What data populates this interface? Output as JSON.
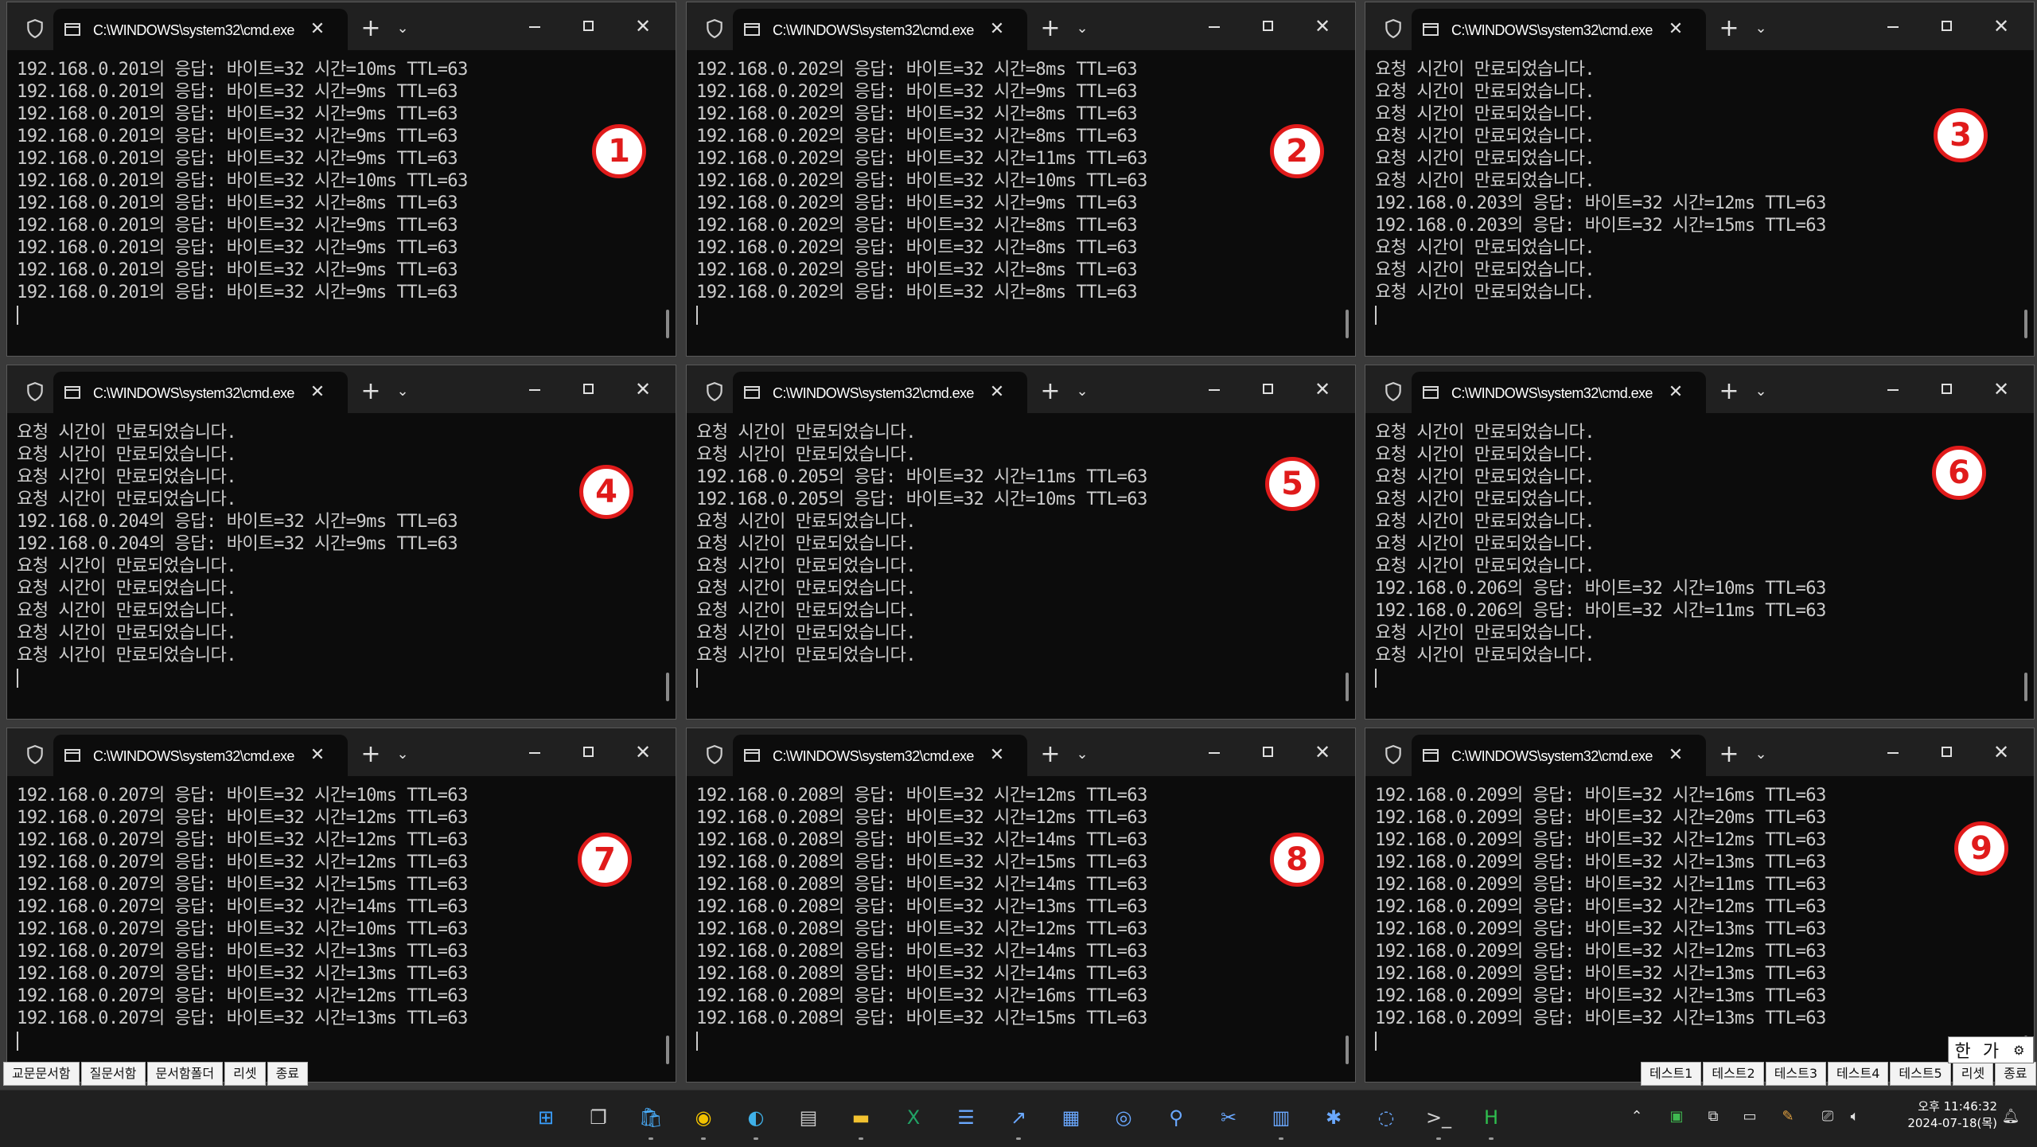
{
  "terminals": [
    {
      "title": "C:\\WINDOWS\\system32\\cmd.exe",
      "close_glyph": "✕",
      "number": "1",
      "lines": [
        "192.168.0.201의 응답: 바이트=32 시간=10ms TTL=63",
        "192.168.0.201의 응답: 바이트=32 시간=9ms TTL=63",
        "192.168.0.201의 응답: 바이트=32 시간=9ms TTL=63",
        "192.168.0.201의 응답: 바이트=32 시간=9ms TTL=63",
        "192.168.0.201의 응답: 바이트=32 시간=9ms TTL=63",
        "192.168.0.201의 응답: 바이트=32 시간=10ms TTL=63",
        "192.168.0.201의 응답: 바이트=32 시간=8ms TTL=63",
        "192.168.0.201의 응답: 바이트=32 시간=9ms TTL=63",
        "192.168.0.201의 응답: 바이트=32 시간=9ms TTL=63",
        "192.168.0.201의 응답: 바이트=32 시간=9ms TTL=63",
        "192.168.0.201의 응답: 바이트=32 시간=9ms TTL=63"
      ]
    },
    {
      "title": "C:\\WINDOWS\\system32\\cmd.exe",
      "close_glyph": "✕",
      "number": "2",
      "lines": [
        "192.168.0.202의 응답: 바이트=32 시간=8ms TTL=63",
        "192.168.0.202의 응답: 바이트=32 시간=9ms TTL=63",
        "192.168.0.202의 응답: 바이트=32 시간=8ms TTL=63",
        "192.168.0.202의 응답: 바이트=32 시간=8ms TTL=63",
        "192.168.0.202의 응답: 바이트=32 시간=11ms TTL=63",
        "192.168.0.202의 응답: 바이트=32 시간=10ms TTL=63",
        "192.168.0.202의 응답: 바이트=32 시간=9ms TTL=63",
        "192.168.0.202의 응답: 바이트=32 시간=8ms TTL=63",
        "192.168.0.202의 응답: 바이트=32 시간=8ms TTL=63",
        "192.168.0.202의 응답: 바이트=32 시간=8ms TTL=63",
        "192.168.0.202의 응답: 바이트=32 시간=8ms TTL=63"
      ]
    },
    {
      "title": "C:\\WINDOWS\\system32\\cmd.exe",
      "close_glyph": "✕",
      "number": "3",
      "lines": [
        "요청 시간이 만료되었습니다.",
        "요청 시간이 만료되었습니다.",
        "요청 시간이 만료되었습니다.",
        "요청 시간이 만료되었습니다.",
        "요청 시간이 만료되었습니다.",
        "요청 시간이 만료되었습니다.",
        "192.168.0.203의 응답: 바이트=32 시간=12ms TTL=63",
        "192.168.0.203의 응답: 바이트=32 시간=15ms TTL=63",
        "요청 시간이 만료되었습니다.",
        "요청 시간이 만료되었습니다.",
        "요청 시간이 만료되었습니다."
      ]
    },
    {
      "title": "C:\\WINDOWS\\system32\\cmd.exe",
      "close_glyph": "✕",
      "number": "4",
      "lines": [
        "요청 시간이 만료되었습니다.",
        "요청 시간이 만료되었습니다.",
        "요청 시간이 만료되었습니다.",
        "요청 시간이 만료되었습니다.",
        "192.168.0.204의 응답: 바이트=32 시간=9ms TTL=63",
        "192.168.0.204의 응답: 바이트=32 시간=9ms TTL=63",
        "요청 시간이 만료되었습니다.",
        "요청 시간이 만료되었습니다.",
        "요청 시간이 만료되었습니다.",
        "요청 시간이 만료되었습니다.",
        "요청 시간이 만료되었습니다."
      ]
    },
    {
      "title": "C:\\WINDOWS\\system32\\cmd.exe",
      "close_glyph": "✕",
      "number": "5",
      "lines": [
        "요청 시간이 만료되었습니다.",
        "요청 시간이 만료되었습니다.",
        "192.168.0.205의 응답: 바이트=32 시간=11ms TTL=63",
        "192.168.0.205의 응답: 바이트=32 시간=10ms TTL=63",
        "요청 시간이 만료되었습니다.",
        "요청 시간이 만료되었습니다.",
        "요청 시간이 만료되었습니다.",
        "요청 시간이 만료되었습니다.",
        "요청 시간이 만료되었습니다.",
        "요청 시간이 만료되었습니다.",
        "요청 시간이 만료되었습니다."
      ]
    },
    {
      "title": "C:\\WINDOWS\\system32\\cmd.exe",
      "close_glyph": "✕",
      "number": "6",
      "lines": [
        "요청 시간이 만료되었습니다.",
        "요청 시간이 만료되었습니다.",
        "요청 시간이 만료되었습니다.",
        "요청 시간이 만료되었습니다.",
        "요청 시간이 만료되었습니다.",
        "요청 시간이 만료되었습니다.",
        "요청 시간이 만료되었습니다.",
        "192.168.0.206의 응답: 바이트=32 시간=10ms TTL=63",
        "192.168.0.206의 응답: 바이트=32 시간=11ms TTL=63",
        "요청 시간이 만료되었습니다.",
        "요청 시간이 만료되었습니다."
      ]
    },
    {
      "title": "C:\\WINDOWS\\system32\\cmd.exe",
      "close_glyph": "✕",
      "number": "7",
      "lines": [
        "192.168.0.207의 응답: 바이트=32 시간=10ms TTL=63",
        "192.168.0.207의 응답: 바이트=32 시간=12ms TTL=63",
        "192.168.0.207의 응답: 바이트=32 시간=12ms TTL=63",
        "192.168.0.207의 응답: 바이트=32 시간=12ms TTL=63",
        "192.168.0.207의 응답: 바이트=32 시간=15ms TTL=63",
        "192.168.0.207의 응답: 바이트=32 시간=14ms TTL=63",
        "192.168.0.207의 응답: 바이트=32 시간=10ms TTL=63",
        "192.168.0.207의 응답: 바이트=32 시간=13ms TTL=63",
        "192.168.0.207의 응답: 바이트=32 시간=13ms TTL=63",
        "192.168.0.207의 응답: 바이트=32 시간=12ms TTL=63",
        "192.168.0.207의 응답: 바이트=32 시간=13ms TTL=63"
      ]
    },
    {
      "title": "C:\\WINDOWS\\system32\\cmd.exe",
      "close_glyph": "✕",
      "number": "8",
      "lines": [
        "192.168.0.208의 응답: 바이트=32 시간=12ms TTL=63",
        "192.168.0.208의 응답: 바이트=32 시간=12ms TTL=63",
        "192.168.0.208의 응답: 바이트=32 시간=14ms TTL=63",
        "192.168.0.208의 응답: 바이트=32 시간=15ms TTL=63",
        "192.168.0.208의 응답: 바이트=32 시간=14ms TTL=63",
        "192.168.0.208의 응답: 바이트=32 시간=13ms TTL=63",
        "192.168.0.208의 응답: 바이트=32 시간=12ms TTL=63",
        "192.168.0.208의 응답: 바이트=32 시간=14ms TTL=63",
        "192.168.0.208의 응답: 바이트=32 시간=14ms TTL=63",
        "192.168.0.208의 응답: 바이트=32 시간=16ms TTL=63",
        "192.168.0.208의 응답: 바이트=32 시간=15ms TTL=63"
      ]
    },
    {
      "title": "C:\\WINDOWS\\system32\\cmd.exe",
      "close_glyph": "✕",
      "number": "9",
      "lines": [
        "192.168.0.209의 응답: 바이트=32 시간=16ms TTL=63",
        "192.168.0.209의 응답: 바이트=32 시간=20ms TTL=63",
        "192.168.0.209의 응답: 바이트=32 시간=12ms TTL=63",
        "192.168.0.209의 응답: 바이트=32 시간=13ms TTL=63",
        "192.168.0.209의 응답: 바이트=32 시간=11ms TTL=63",
        "192.168.0.209의 응답: 바이트=32 시간=12ms TTL=63",
        "192.168.0.209의 응답: 바이트=32 시간=13ms TTL=63",
        "192.168.0.209의 응답: 바이트=32 시간=12ms TTL=63",
        "192.168.0.209의 응답: 바이트=32 시간=13ms TTL=63",
        "192.168.0.209의 응답: 바이트=32 시간=13ms TTL=63",
        "192.168.0.209의 응답: 바이트=32 시간=13ms TTL=63"
      ]
    }
  ],
  "left_strip": [
    "교문문서함",
    "질문서함",
    "문서함폴더",
    "리셋",
    "종료"
  ],
  "right_strip": [
    "테스트1",
    "테스트2",
    "테스트3",
    "테스트4",
    "테스트5",
    "리셋",
    "종료"
  ],
  "ime": {
    "lang": "한",
    "mode": "가"
  },
  "taskbar_icons": [
    "windows-start-icon",
    "task-view-icon",
    "store-icon",
    "chrome-icon",
    "edge-icon",
    "folder-icon",
    "explorer-icon",
    "excel-icon",
    "notepad-icon",
    "share-icon",
    "clipboard-icon",
    "camera-icon",
    "search-icon",
    "scissors-icon",
    "trash-icon",
    "network-icon",
    "globe-icon",
    "terminal-icon",
    "hancom-icon"
  ],
  "clock": {
    "time": "오후 11:46:32",
    "date": "2024-07-18(목)"
  },
  "colors": {
    "badge": "#e01b1b",
    "terminal_text": "#cccccc",
    "terminal_bg": "#0c0c0c"
  }
}
